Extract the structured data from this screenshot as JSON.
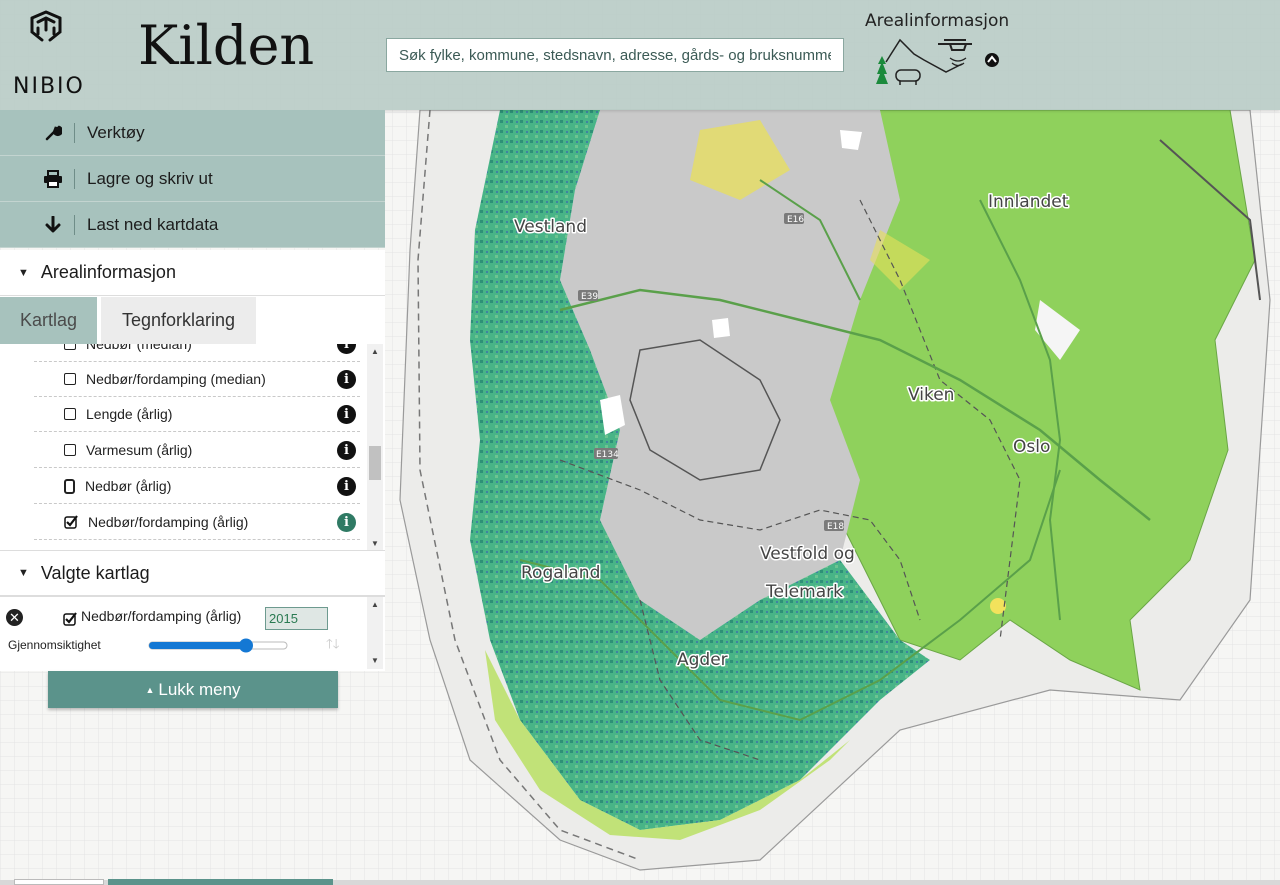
{
  "header": {
    "logo_text": "NIBIO",
    "app_title": "Kilden",
    "search_placeholder": "Søk fylke, kommune, stedsnavn, adresse, gårds- og bruksnummer",
    "theme_title": "Arealinformasjon"
  },
  "tools": {
    "items": [
      {
        "label": "Verktøy",
        "icon": "wrench-icon"
      },
      {
        "label": "Lagre og skriv ut",
        "icon": "printer-icon"
      },
      {
        "label": "Last ned kartdata",
        "icon": "download-arrow-icon"
      }
    ]
  },
  "sections": {
    "arealinfo": "Arealinformasjon",
    "selected": "Valgte kartlag"
  },
  "tabs": {
    "kartlag": "Kartlag",
    "tegnforklaring": "Tegnforklaring"
  },
  "layers": [
    {
      "label": "Nedbør (median)",
      "checked": false
    },
    {
      "label": "Nedbør/fordamping (median)",
      "checked": false
    },
    {
      "label": "Lengde (årlig)",
      "checked": false
    },
    {
      "label": "Varmesum (årlig)",
      "checked": false
    },
    {
      "label": "Nedbør (årlig)",
      "checked": false
    },
    {
      "label": "Nedbør/fordamping (årlig)",
      "checked": true
    }
  ],
  "selected_layer": {
    "label": "Nedbør/fordamping (årlig)",
    "year": "2015",
    "opacity_label": "Gjennomsiktighet",
    "opacity": 0.7
  },
  "close_menu": "Lukk meny",
  "map": {
    "labels": [
      "Vestland",
      "Innlandet",
      "Viken",
      "Oslo",
      "Vestfold og",
      "Telemark",
      "Rogaland",
      "Agder"
    ],
    "road_shields": [
      "E16",
      "E39",
      "E134",
      "E18"
    ]
  },
  "colors": {
    "header_bg": "#bacdc7",
    "panel_accent": "#a7c2bd",
    "button_accent": "#5b938b",
    "info_active": "#2f7a64",
    "map_green": "#8fd15c",
    "map_teal": "#3fae86",
    "map_grey": "#c9c9c9"
  }
}
